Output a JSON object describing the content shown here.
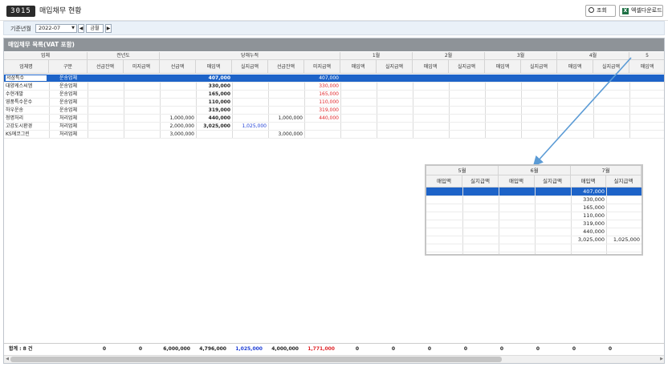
{
  "header": {
    "screen_no": "3015",
    "title": "매입채무 현황",
    "search_label": "조회",
    "excel_label": "엑셀다운로드"
  },
  "filter": {
    "label": "기준년월",
    "month_value": "2022-07",
    "prev": "◀",
    "current": "금월",
    "next": "▶"
  },
  "grid": {
    "title": "매입채무 목록(VAT 포함)",
    "groups": {
      "vendor": "업체",
      "prev_year": "전년도",
      "current": "당해누적",
      "m1": "1월",
      "m2": "2월",
      "m3": "3월",
      "m4": "4월",
      "m5": "5"
    },
    "subheaders": {
      "vendor_name": "업체명",
      "category": "구분",
      "prepay": "선급잔액",
      "unpaid": "미지급액",
      "prepay_amt": "선급액",
      "purchase": "매입액",
      "paid": "실지급액",
      "purchase_short": "매입액",
      "paid_short": "실지급액"
    },
    "rows": [
      {
        "name": "서삼특수",
        "cat": "운송업체",
        "prepay": "",
        "purchase": "407,000",
        "paid": "",
        "prepay_bal": "",
        "unpaid": "407,000"
      },
      {
        "name": "대양케스씨엠",
        "cat": "운송업체",
        "prepay": "",
        "purchase": "330,000",
        "paid": "",
        "prepay_bal": "",
        "unpaid": "330,000"
      },
      {
        "name": "수현개발",
        "cat": "운송업체",
        "prepay": "",
        "purchase": "165,000",
        "paid": "",
        "prepay_bal": "",
        "unpaid": "165,000"
      },
      {
        "name": "영풍특수운수",
        "cat": "운송업체",
        "prepay": "",
        "purchase": "110,000",
        "paid": "",
        "prepay_bal": "",
        "unpaid": "110,000"
      },
      {
        "name": "하우운송",
        "cat": "운송업체",
        "prepay": "",
        "purchase": "319,000",
        "paid": "",
        "prepay_bal": "",
        "unpaid": "319,000"
      },
      {
        "name": "청명처리",
        "cat": "처리업체",
        "prepay": "1,000,000",
        "purchase": "440,000",
        "paid": "",
        "prepay_bal": "1,000,000",
        "unpaid": "440,000"
      },
      {
        "name": "고강도시환경",
        "cat": "처리업체",
        "prepay": "2,000,000",
        "purchase": "3,025,000",
        "paid": "1,025,000",
        "prepay_bal": "",
        "unpaid": ""
      },
      {
        "name": "KS에코그린",
        "cat": "처리업체",
        "prepay": "3,000,000",
        "purchase": "",
        "paid": "",
        "prepay_bal": "3,000,000",
        "unpaid": ""
      }
    ],
    "footer": {
      "label": "합계 : 8 건",
      "prev_prepay": "0",
      "prev_unpaid": "0",
      "prepay": "6,000,000",
      "purchase": "4,796,000",
      "paid": "1,025,000",
      "prepay_bal": "4,000,000",
      "unpaid": "1,771,000",
      "m1a": "0",
      "m1b": "0",
      "m2a": "0",
      "m2b": "0",
      "m3a": "0",
      "m3b": "0",
      "m4a": "0",
      "m4b": "0"
    }
  },
  "zoom": {
    "months": [
      "5월",
      "6월",
      "7월"
    ],
    "purchase": "매입액",
    "paid": "실지급액",
    "m7_purchase": [
      "407,000",
      "330,000",
      "165,000",
      "110,000",
      "319,000",
      "440,000",
      "3,025,000",
      ""
    ],
    "m7_paid": [
      "",
      "",
      "",
      "",
      "",
      "",
      "1,025,000",
      ""
    ]
  },
  "colors": {
    "selected_row": "#1d63c8",
    "negative_red": "#e0262a",
    "paid_blue": "#1f3fd6",
    "panel_header": "#8e9398",
    "arrow": "#5b9bd5"
  }
}
